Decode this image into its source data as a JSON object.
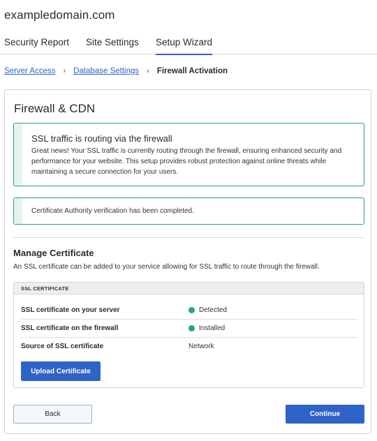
{
  "site": {
    "title": "exampledomain.com"
  },
  "tabs": [
    {
      "label": "Security Report",
      "active": false
    },
    {
      "label": "Site Settings",
      "active": false
    },
    {
      "label": "Setup Wizard",
      "active": true
    }
  ],
  "breadcrumb": {
    "items": [
      "Server Access",
      "Database Settings"
    ],
    "current": "Firewall Activation",
    "separator": "›"
  },
  "card": {
    "title": "Firewall & CDN",
    "alert_routing": {
      "title": "SSL traffic is routing via the firewall",
      "body": "Great news! Your SSL traffic is currently routing through the firewall, ensuring enhanced security and performance for your website. This setup provides robust protection against online threats while maintaining a secure connection for your users."
    },
    "alert_ca": {
      "message": "Certificate Authority verification has been completed."
    },
    "manage": {
      "title": "Manage Certificate",
      "description": "An SSL certificate can be added to your service allowing for SSL traffic to route through the firewall."
    },
    "ssl_table": {
      "header": "SSL CERTIFICATE",
      "rows": [
        {
          "label": "SSL certificate on your server",
          "value": "Detected",
          "status_icon": "green-dot"
        },
        {
          "label": "SSL certificate on the firewall",
          "value": "Installed",
          "status_icon": "green-dot"
        },
        {
          "label": "Source of SSL certificate",
          "value": "Network"
        }
      ],
      "upload_label": "Upload Certificate"
    },
    "footer": {
      "back_label": "Back",
      "continue_label": "Continue"
    }
  },
  "colors": {
    "accent": "#2f63c7",
    "success_border": "#2e9e79",
    "success_stripe": "#e4f3ee",
    "status_green": "#23a870"
  }
}
